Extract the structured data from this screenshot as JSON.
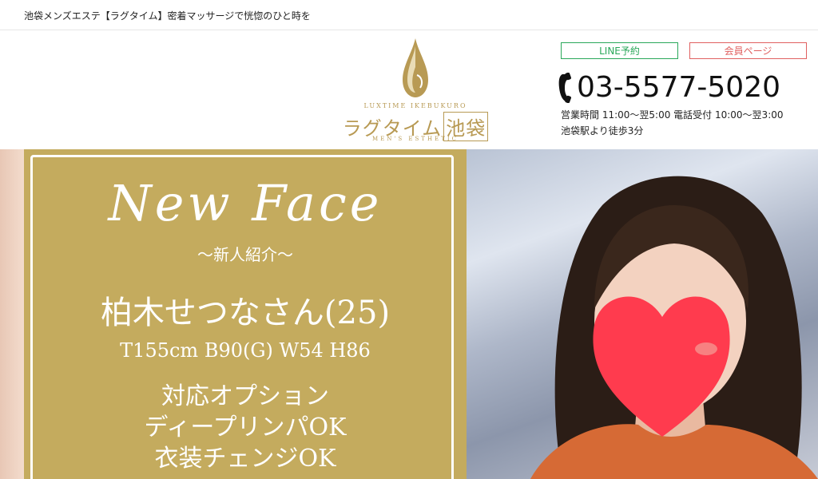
{
  "topbar": {
    "tagline": "池袋メンズエステ【ラグタイム】密着マッサージで恍惚のひと時を"
  },
  "header": {
    "logo": {
      "top_text": "LUXTIME IKEBUKURO",
      "brand": "ラグタイム",
      "brand_boxed": "池袋",
      "bottom_text": "MEN'S ESTHETIC"
    },
    "line_button": "LINE予約",
    "member_button": "会員ページ",
    "phone": "03-5577-5020",
    "hours": "営業時間  11:00～翌5:00 電話受付  10:00～翌3:00",
    "access": "池袋駅より徒歩3分"
  },
  "banner": {
    "title": "New Face",
    "subtitle": "～新人紹介～",
    "name": "柏木せつなさん(25)",
    "size": "T155cm B90(G) W54 H86",
    "options": [
      "対応オプション",
      "ディープリンパOK",
      "衣装チェンジOK"
    ]
  },
  "colors": {
    "gold": "#c4ab5e",
    "logo_gold": "#b89a54",
    "line_green": "#2aa85a",
    "member_red": "#e06060",
    "heart_red": "#ff3b4e"
  }
}
